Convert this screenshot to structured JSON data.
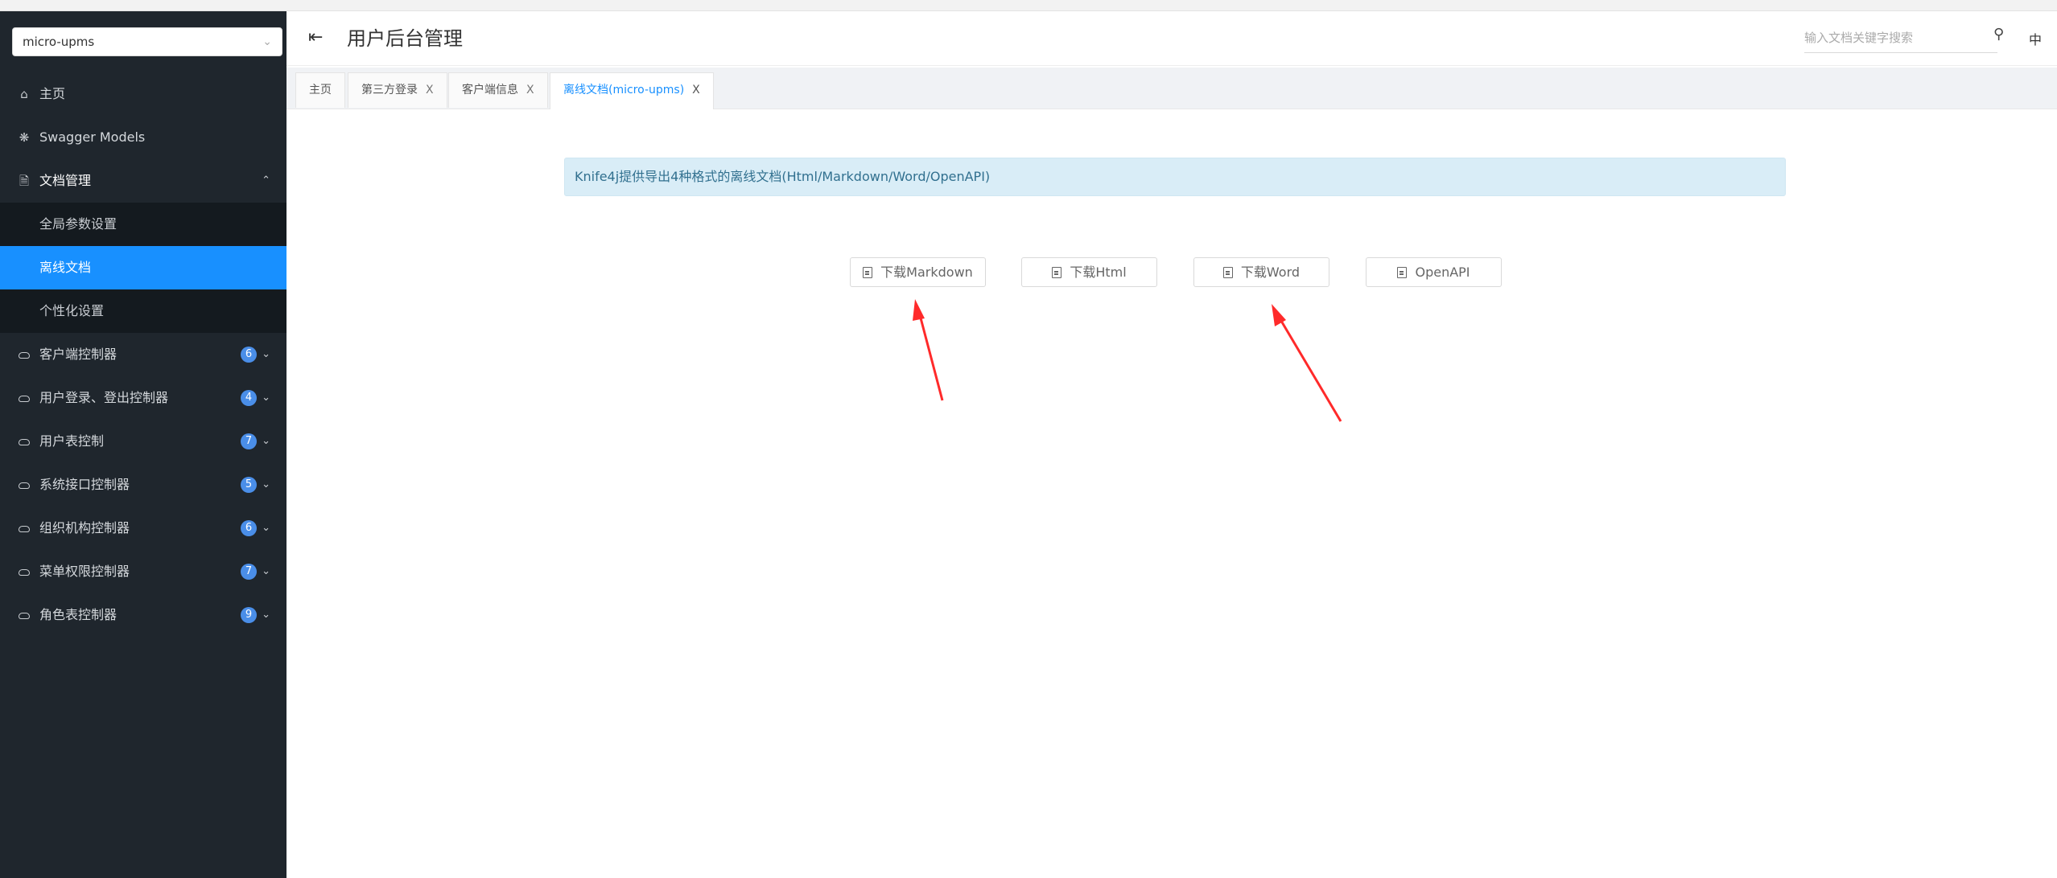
{
  "sidebar": {
    "service": "micro-upms",
    "items": [
      {
        "label": "主页",
        "icon": "home-icon"
      },
      {
        "label": "Swagger Models",
        "icon": "models-icon"
      },
      {
        "label": "文档管理",
        "icon": "document-icon"
      }
    ],
    "sub_items": [
      {
        "label": "全局参数设置"
      },
      {
        "label": "离线文档"
      },
      {
        "label": "个性化设置"
      }
    ],
    "controllers": [
      {
        "label": "客户端控制器",
        "count": "6"
      },
      {
        "label": "用户登录、登出控制器",
        "count": "4"
      },
      {
        "label": "用户表控制",
        "count": "7"
      },
      {
        "label": "系统接口控制器",
        "count": "5"
      },
      {
        "label": "组织机构控制器",
        "count": "6"
      },
      {
        "label": "菜单权限控制器",
        "count": "7"
      },
      {
        "label": "角色表控制器",
        "count": "9"
      }
    ]
  },
  "header": {
    "title": "用户后台管理",
    "search_placeholder": "输入文档关键字搜索",
    "lang": "中"
  },
  "tabs": [
    {
      "label": "主页"
    },
    {
      "label": "第三方登录",
      "close": "X"
    },
    {
      "label": "客户端信息",
      "close": "X"
    },
    {
      "label": "离线文档(micro-upms)",
      "close": "X"
    }
  ],
  "content": {
    "alert": "Knife4j提供导出4种格式的离线文档(Html/Markdown/Word/OpenAPI)",
    "buttons": [
      {
        "label": "下载Markdown"
      },
      {
        "label": "下载Html"
      },
      {
        "label": "下载Word"
      },
      {
        "label": "OpenAPI"
      }
    ]
  },
  "colors": {
    "sidebar_bg": "#1f262d",
    "active": "#1890ff",
    "alert_bg": "#d9edf7",
    "annotation_arrow": "#ff2a2a"
  }
}
